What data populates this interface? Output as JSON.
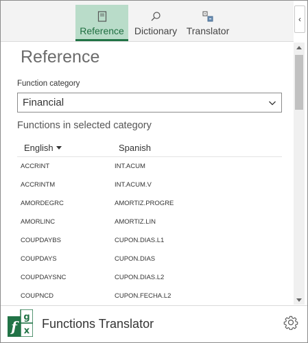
{
  "tabs": [
    {
      "label": "Reference",
      "icon": "book-icon",
      "active": true
    },
    {
      "label": "Dictionary",
      "icon": "search-icon",
      "active": false
    },
    {
      "label": "Translator",
      "icon": "translate-icon",
      "active": false
    }
  ],
  "collapse_glyph": "‹",
  "page_title": "Reference",
  "category": {
    "label": "Function category",
    "selected": "Financial"
  },
  "section_title": "Functions in selected category",
  "table": {
    "headers": {
      "english": "English",
      "spanish": "Spanish"
    },
    "rows": [
      {
        "en": "ACCRINT",
        "es": "INT.ACUM"
      },
      {
        "en": "ACCRINTM",
        "es": "INT.ACUM.V"
      },
      {
        "en": "AMORDEGRC",
        "es": "AMORTIZ.PROGRE"
      },
      {
        "en": "AMORLINC",
        "es": "AMORTIZ.LIN"
      },
      {
        "en": "COUPDAYBS",
        "es": "CUPON.DIAS.L1"
      },
      {
        "en": "COUPDAYS",
        "es": "CUPON.DIAS"
      },
      {
        "en": "COUPDAYSNC",
        "es": "CUPON.DIAS.L2"
      },
      {
        "en": "COUPNCD",
        "es": "CUPON.FECHA.L2"
      }
    ]
  },
  "footer": {
    "title": "Functions Translator",
    "logo_letters": [
      "f",
      "g",
      "x"
    ]
  },
  "colors": {
    "accent": "#217346",
    "active_tab_bg": "#b9dcc9"
  }
}
